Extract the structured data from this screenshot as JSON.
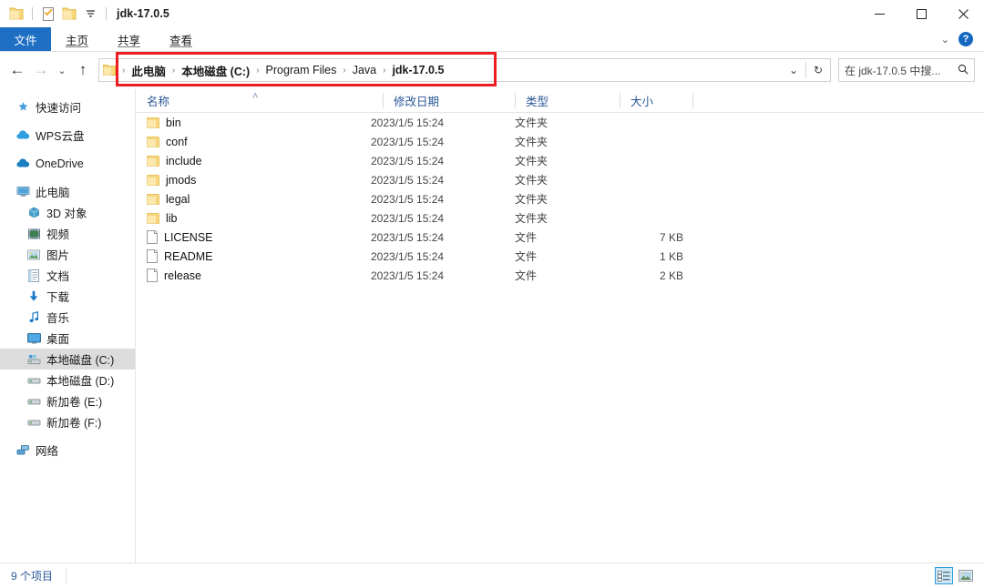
{
  "window": {
    "title": "jdk-17.0.5",
    "quick_access": [
      {
        "name": "folder-icon",
        "label": ""
      },
      {
        "name": "properties-icon",
        "label": ""
      },
      {
        "name": "new-folder-icon",
        "label": ""
      },
      {
        "name": "customize-qat-icon",
        "label": ""
      }
    ],
    "controls": {
      "minimize": "─",
      "maximize": "☐",
      "close": "✕"
    }
  },
  "ribbon": {
    "tabs": [
      {
        "label": "文件",
        "active": true
      },
      {
        "label": "主页",
        "active": false
      },
      {
        "label": "共享",
        "active": false
      },
      {
        "label": "查看",
        "active": false
      }
    ],
    "collapse_chevron": "⌄",
    "help_label": "?"
  },
  "address": {
    "back": "←",
    "forward": "→",
    "recent": "⌄",
    "up": "↑",
    "breadcrumbs": [
      "此电脑",
      "本地磁盘 (C:)",
      "Program Files",
      "Java",
      "jdk-17.0.5"
    ],
    "separator": "›",
    "history_dropdown": "⌄",
    "refresh": "↻",
    "search_placeholder": "在 jdk-17.0.5 中搜...",
    "search_icon": "⌕",
    "highlight_color": "#ec1c24"
  },
  "sidebar": {
    "items": [
      {
        "label": "快速访问",
        "icon": "star-icon",
        "level": 0,
        "selected": false
      },
      {
        "label": "WPS云盘",
        "icon": "cloud-icon",
        "level": 0,
        "selected": false
      },
      {
        "label": "OneDrive",
        "icon": "onedrive-icon",
        "level": 0,
        "selected": false
      },
      {
        "label": "此电脑",
        "icon": "computer-icon",
        "level": 0,
        "selected": false
      },
      {
        "label": "3D 对象",
        "icon": "3d-objects-icon",
        "level": 1,
        "selected": false
      },
      {
        "label": "视频",
        "icon": "video-icon",
        "level": 1,
        "selected": false
      },
      {
        "label": "图片",
        "icon": "pictures-icon",
        "level": 1,
        "selected": false
      },
      {
        "label": "文档",
        "icon": "documents-icon",
        "level": 1,
        "selected": false
      },
      {
        "label": "下载",
        "icon": "downloads-icon",
        "level": 1,
        "selected": false
      },
      {
        "label": "音乐",
        "icon": "music-icon",
        "level": 1,
        "selected": false
      },
      {
        "label": "桌面",
        "icon": "desktop-icon",
        "level": 1,
        "selected": false
      },
      {
        "label": "本地磁盘 (C:)",
        "icon": "system-drive-icon",
        "level": 1,
        "selected": true
      },
      {
        "label": "本地磁盘 (D:)",
        "icon": "drive-icon",
        "level": 1,
        "selected": false
      },
      {
        "label": "新加卷 (E:)",
        "icon": "drive-icon",
        "level": 1,
        "selected": false
      },
      {
        "label": "新加卷 (F:)",
        "icon": "drive-icon",
        "level": 1,
        "selected": false
      },
      {
        "label": "网络",
        "icon": "network-icon",
        "level": 0,
        "selected": false
      }
    ]
  },
  "filelist": {
    "columns": [
      {
        "label": "名称",
        "sorted": "asc"
      },
      {
        "label": "修改日期",
        "sorted": ""
      },
      {
        "label": "类型",
        "sorted": ""
      },
      {
        "label": "大小",
        "sorted": ""
      }
    ],
    "sort_caret": "˄",
    "rows": [
      {
        "name": "bin",
        "date": "2023/1/5 15:24",
        "type": "文件夹",
        "size": "",
        "icon": "folder-icon"
      },
      {
        "name": "conf",
        "date": "2023/1/5 15:24",
        "type": "文件夹",
        "size": "",
        "icon": "folder-icon"
      },
      {
        "name": "include",
        "date": "2023/1/5 15:24",
        "type": "文件夹",
        "size": "",
        "icon": "folder-icon"
      },
      {
        "name": "jmods",
        "date": "2023/1/5 15:24",
        "type": "文件夹",
        "size": "",
        "icon": "folder-icon"
      },
      {
        "name": "legal",
        "date": "2023/1/5 15:24",
        "type": "文件夹",
        "size": "",
        "icon": "folder-icon"
      },
      {
        "name": "lib",
        "date": "2023/1/5 15:24",
        "type": "文件夹",
        "size": "",
        "icon": "folder-icon"
      },
      {
        "name": "LICENSE",
        "date": "2023/1/5 15:24",
        "type": "文件",
        "size": "7 KB",
        "icon": "file-icon"
      },
      {
        "name": "README",
        "date": "2023/1/5 15:24",
        "type": "文件",
        "size": "1 KB",
        "icon": "file-icon"
      },
      {
        "name": "release",
        "date": "2023/1/5 15:24",
        "type": "文件",
        "size": "2 KB",
        "icon": "file-icon"
      }
    ]
  },
  "statusbar": {
    "item_count": "9 个项目",
    "views": [
      {
        "name": "details-view-button",
        "active": true
      },
      {
        "name": "large-icons-view-button",
        "active": false
      }
    ]
  }
}
